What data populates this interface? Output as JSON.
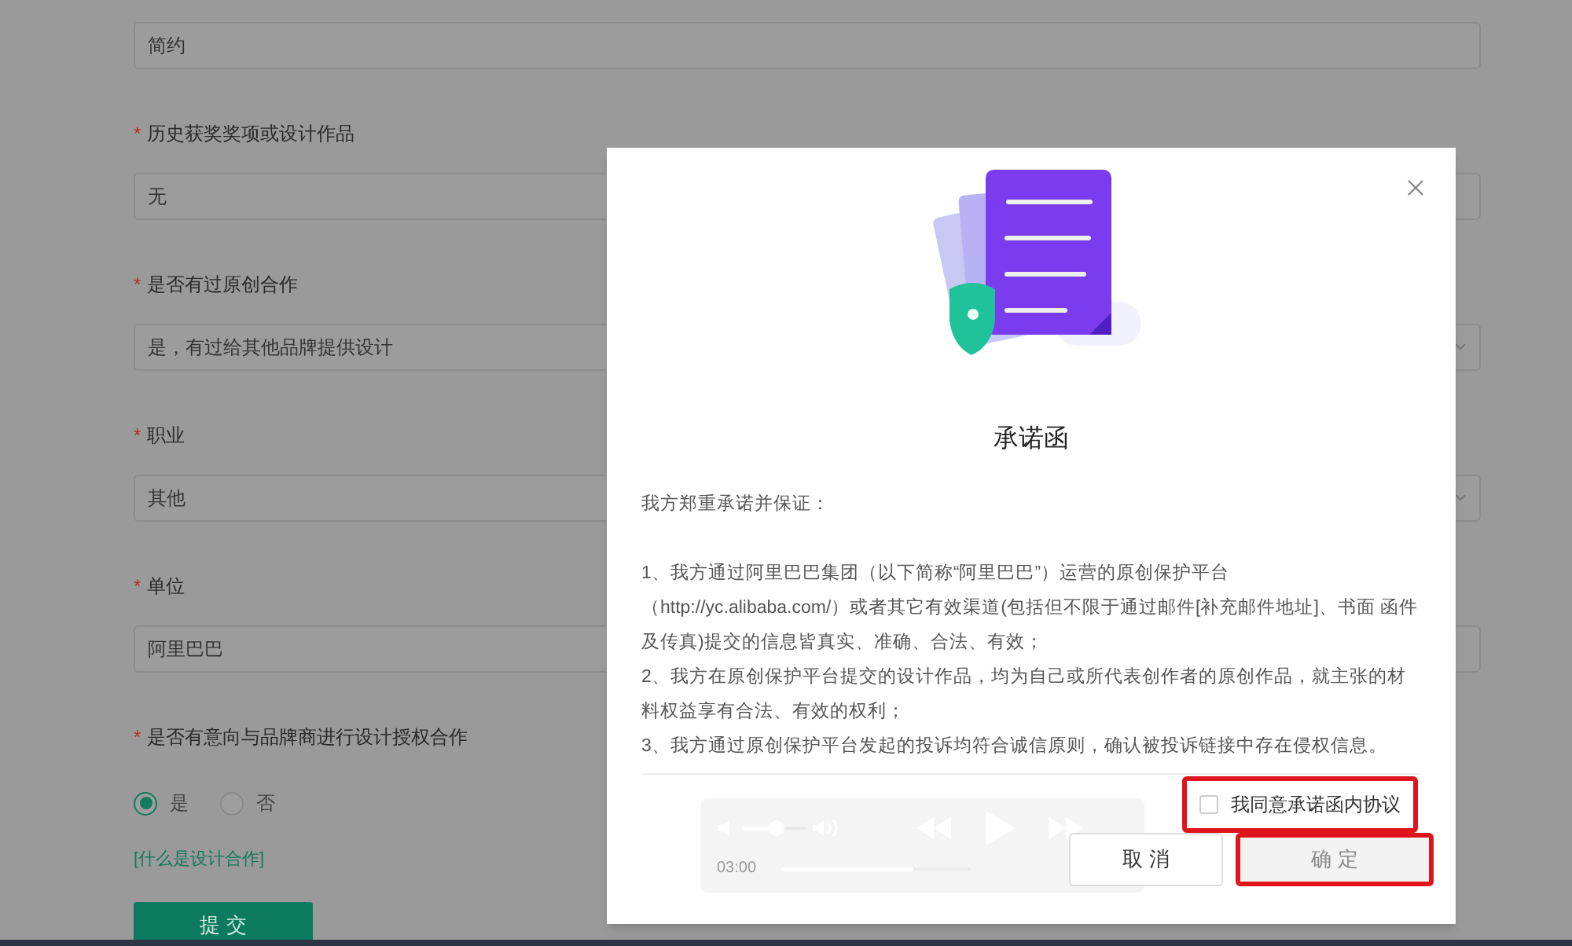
{
  "form": {
    "fields": [
      {
        "value": "简约",
        "kind": "input"
      },
      {
        "required_mark": "*",
        "label": "历史获奖奖项或设计作品",
        "value": "无",
        "kind": "input"
      },
      {
        "required_mark": "*",
        "label": "是否有过原创合作",
        "value": "是，有过给其他品牌提供设计",
        "kind": "select"
      },
      {
        "required_mark": "*",
        "label": "职业",
        "value": "其他",
        "kind": "select"
      },
      {
        "required_mark": "*",
        "label": "单位",
        "value": "阿里巴巴",
        "kind": "input"
      }
    ],
    "radio_group": {
      "required_mark": "*",
      "label": "是否有意向与品牌商进行设计授权合作",
      "options": [
        {
          "label": "是",
          "selected": true
        },
        {
          "label": "否",
          "selected": false
        }
      ]
    },
    "help_link": "[什么是设计合作]",
    "submit": "提 交"
  },
  "modal": {
    "title": "承诺函",
    "intro": "我方郑重承诺并保证：",
    "paragraphs": [
      "1、我方通过阿里巴巴集团（以下简称“阿里巴巴”）运营的原创保护平台（http://yc.alibaba.com/）或者其它有效渠道(包括但不限于通过邮件[补充邮件地址]、书面 函件及传真)提交的信息皆真实、准确、合法、有效；",
      "2、我方在原创保护平台提交的设计作品，均为自己或所代表创作者的原创作品，就主张的材料权益享有合法、有效的权利；",
      "3、我方通过原创保护平台发起的投诉均符合诚信原则，确认被投诉链接中存在侵权信息。"
    ],
    "agree": {
      "label": "我同意承诺函内协议",
      "checked": false,
      "highlighted": true
    },
    "player": {
      "time": "03:00",
      "volume": {
        "level": 0.55
      },
      "progress": {
        "level": 0.7
      }
    },
    "buttons": [
      {
        "label": "取 消",
        "kind": "cancel",
        "disabled": false,
        "highlighted": false
      },
      {
        "label": "确 定",
        "kind": "confirm",
        "disabled": true,
        "highlighted": true
      }
    ]
  }
}
